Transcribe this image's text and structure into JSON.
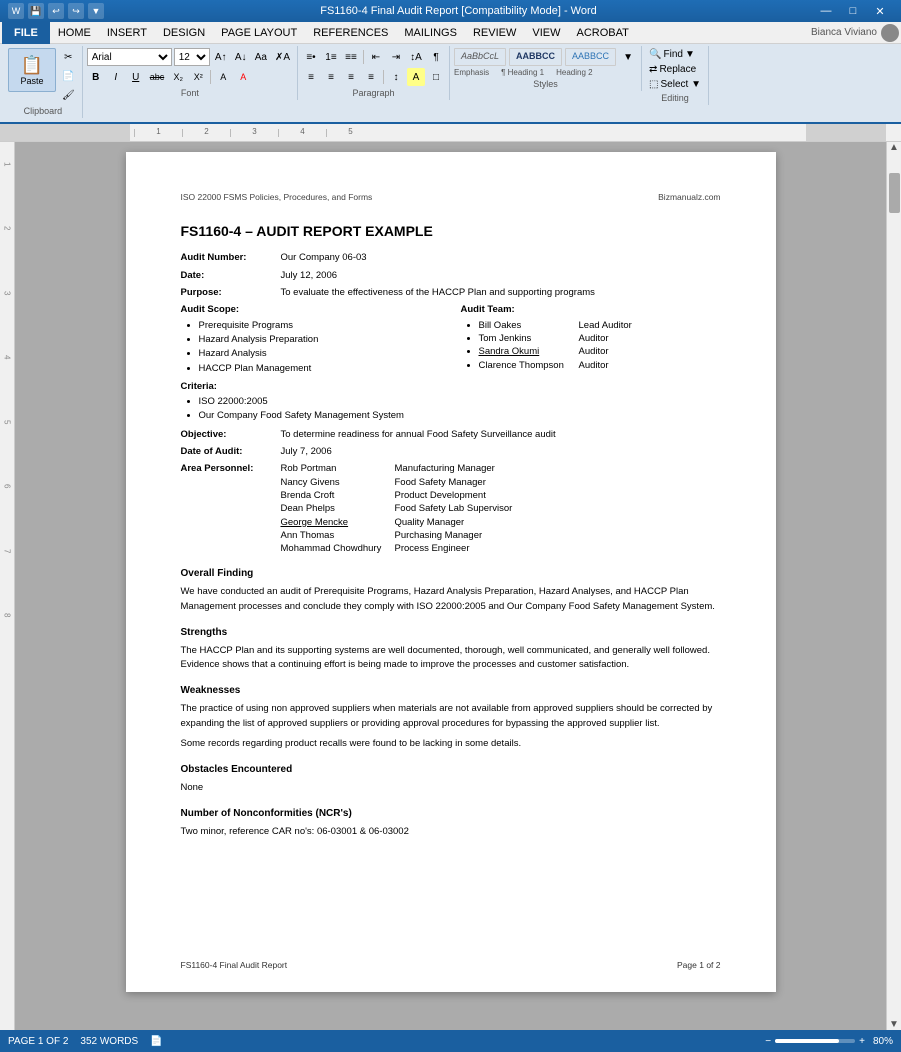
{
  "titleBar": {
    "title": "FS1160-4 Final Audit Report [Compatibility Mode] - Word",
    "minimize": "—",
    "maximize": "□",
    "close": "✕"
  },
  "menuBar": {
    "file": "FILE",
    "items": [
      "HOME",
      "INSERT",
      "DESIGN",
      "PAGE LAYOUT",
      "REFERENCES",
      "MAILINGS",
      "REVIEW",
      "VIEW",
      "ACROBAT"
    ]
  },
  "ribbon": {
    "paste": "Paste",
    "clipboard": "Clipboard",
    "fontName": "Arial",
    "fontSize": "12",
    "bold": "B",
    "italic": "I",
    "underline": "U",
    "strikethrough": "abc",
    "subscript": "X₂",
    "superscript": "X²",
    "fontGroup": "Font",
    "paragraphGroup": "Paragraph",
    "stylesGroup": "Styles",
    "editingGroup": "Editing",
    "styleEmphasis": "AaBbCcL",
    "styleH1": "AABBCC",
    "styleH2": "AABBCC",
    "emphasisLabel": "Emphasis",
    "h1Label": "¶ Heading 1",
    "h2Label": "Heading 2",
    "find": "Find",
    "replace": "Replace",
    "select": "Select ▼"
  },
  "document": {
    "headerLeft": "ISO 22000 FSMS Policies, Procedures, and Forms",
    "headerRight": "Bizmanualz.com",
    "title": "FS1160-4 – AUDIT REPORT EXAMPLE",
    "auditNumber": {
      "label": "Audit Number:",
      "value": "Our Company 06-03"
    },
    "date": {
      "label": "Date:",
      "value": "July 12, 2006"
    },
    "purpose": {
      "label": "Purpose:",
      "value": "To evaluate the effectiveness of the HACCP Plan and supporting programs"
    },
    "auditScope": {
      "label": "Audit Scope:",
      "items": [
        "Prerequisite Programs",
        "Hazard Analysis Preparation",
        "Hazard Analysis",
        "HACCP Plan Management"
      ]
    },
    "auditTeam": {
      "label": "Audit Team:",
      "members": [
        {
          "name": "Bill Oakes",
          "role": "Lead Auditor"
        },
        {
          "name": "Tom Jenkins",
          "role": "Auditor"
        },
        {
          "name": "Sandra Okumi",
          "role": "Auditor"
        },
        {
          "name": "Clarence Thompson",
          "role": "Auditor"
        }
      ]
    },
    "criteria": {
      "label": "Criteria:",
      "items": [
        "ISO 22000:2005",
        "Our Company Food Safety Management System"
      ]
    },
    "objective": {
      "label": "Objective:",
      "value": "To determine readiness for annual Food Safety Surveillance audit"
    },
    "dateOfAudit": {
      "label": "Date of Audit:",
      "value": "July 7, 2006"
    },
    "areaPersonnel": {
      "label": "Area Personnel:",
      "members": [
        {
          "name": "Rob Portman",
          "role": "Manufacturing Manager"
        },
        {
          "name": "Nancy Givens",
          "role": "Food Safety Manager"
        },
        {
          "name": "Brenda Croft",
          "role": "Product Development"
        },
        {
          "name": "Dean Phelps",
          "role": "Food Safety Lab Supervisor"
        },
        {
          "name": "George Mencke",
          "role": "Quality Manager"
        },
        {
          "name": "Ann Thomas",
          "role": "Purchasing Manager"
        },
        {
          "name": "Mohammad Chowdhury",
          "role": "Process Engineer"
        }
      ]
    },
    "overallFinding": {
      "heading": "Overall Finding",
      "text": "We have conducted an audit of Prerequisite Programs, Hazard Analysis Preparation, Hazard Analyses, and HACCP Plan Management processes and conclude they comply with ISO 22000:2005 and Our Company Food Safety Management System."
    },
    "strengths": {
      "heading": "Strengths",
      "text": "The HACCP Plan and its supporting systems are well documented, thorough, well communicated, and generally well followed. Evidence shows that a continuing effort is being made to improve the processes and customer satisfaction."
    },
    "weaknesses": {
      "heading": "Weaknesses",
      "text1": "The practice of using non approved suppliers when materials are not available from approved suppliers should be corrected by expanding the list of approved suppliers or providing approval procedures for bypassing the approved supplier list.",
      "text2": "Some records regarding product recalls were found to be lacking in some details."
    },
    "obstacles": {
      "heading": "Obstacles Encountered",
      "text": "None"
    },
    "ncr": {
      "heading": "Number of Nonconformities (NCR's)",
      "text": "Two minor, reference CAR no's: 06-03001 & 06-03002"
    },
    "footerLeft": "FS1160-4 Final Audit Report",
    "footerRight": "Page 1 of 2"
  },
  "statusBar": {
    "page": "PAGE 1 OF 2",
    "words": "352 WORDS",
    "zoom": "80%"
  }
}
